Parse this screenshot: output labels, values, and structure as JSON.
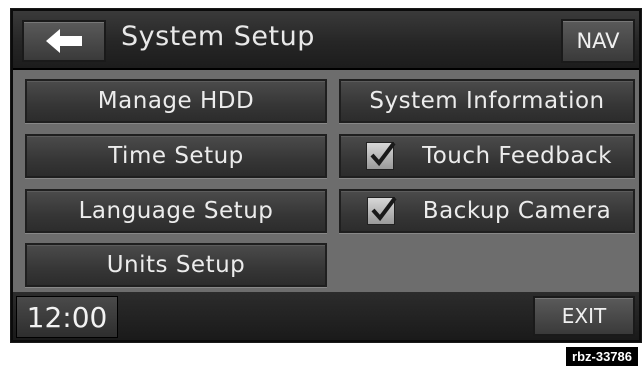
{
  "header": {
    "title": "System Setup",
    "nav_label": "NAV",
    "back_icon": "back-arrow-icon"
  },
  "buttons": {
    "manage_hdd": "Manage HDD",
    "system_information": "System Information",
    "time_setup": "Time Setup",
    "touch_feedback": "Touch Feedback",
    "language_setup": "Language Setup",
    "backup_camera": "Backup Camera",
    "units_setup": "Units Setup"
  },
  "checkboxes": {
    "touch_feedback_checked": true,
    "backup_camera_checked": true
  },
  "footer": {
    "clock": "12:00",
    "exit_label": "EXIT"
  },
  "reference_label": "rbz-33786",
  "colors": {
    "screen_bg": "#0b0b0b",
    "grid_bg": "#6d6d6d",
    "button_bg": "#3a3a3a",
    "text": "#ececec"
  }
}
